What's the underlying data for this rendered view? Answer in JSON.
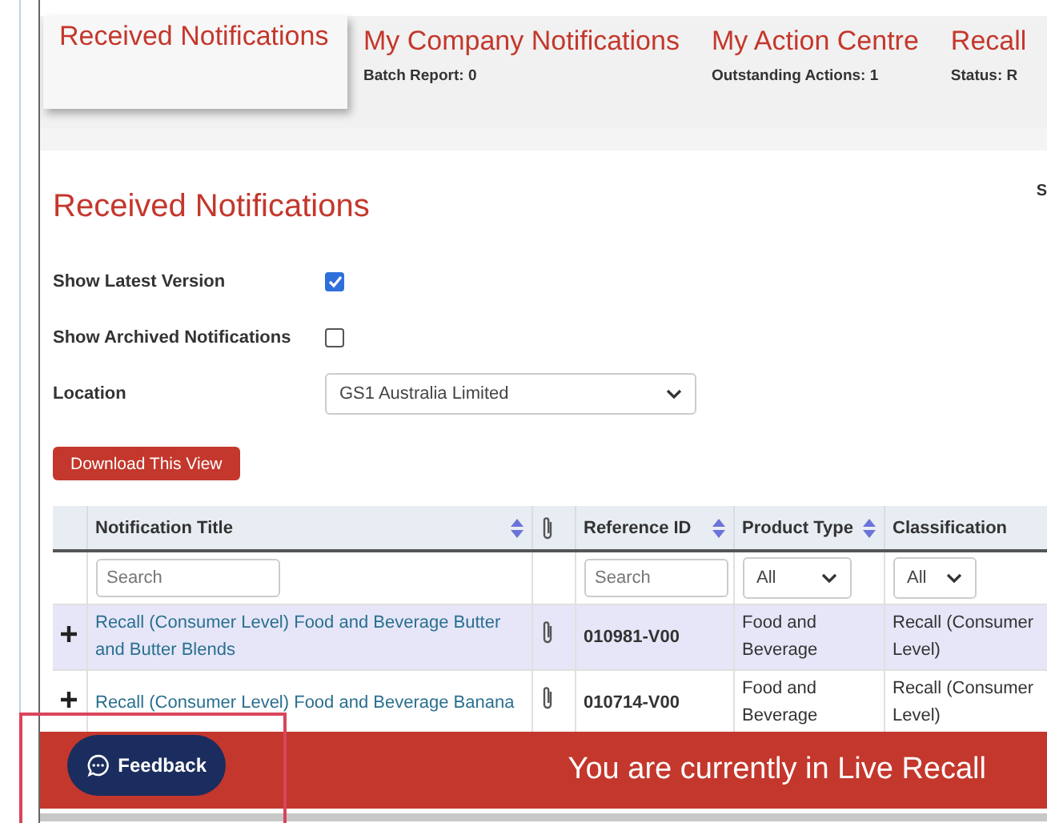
{
  "tabs": [
    {
      "title": "Received Notifications",
      "selected": true
    },
    {
      "title": "My Company Notifications",
      "subtitle": "Batch Report: 0",
      "selected": false
    },
    {
      "title": "My Action Centre",
      "subtitle": "Outstanding Actions: 1",
      "selected": false
    },
    {
      "title": "Recall",
      "subtitle": "Status: R",
      "selected": false
    }
  ],
  "page_title": "Received Notifications",
  "side_label": "S",
  "filters": [
    {
      "kind": "checkbox",
      "label": "Show Latest Version",
      "checked": true
    },
    {
      "kind": "checkbox",
      "label": "Show Archived Notifications",
      "checked": false
    },
    {
      "kind": "select",
      "label": "Location",
      "value": "GS1 Australia Limited"
    }
  ],
  "download_button": "Download This View",
  "table": {
    "columns": [
      {
        "kind": "text",
        "label": "Notification Title",
        "sortable": true,
        "filter": {
          "kind": "search",
          "placeholder": "Search"
        }
      },
      {
        "kind": "attachment",
        "filter": {
          "kind": "none"
        }
      },
      {
        "kind": "text",
        "label": "Reference ID",
        "sortable": true,
        "filter": {
          "kind": "search",
          "placeholder": "Search"
        }
      },
      {
        "kind": "text",
        "label": "Product Type",
        "sortable": true,
        "filter": {
          "kind": "select",
          "value": "All"
        }
      },
      {
        "kind": "text",
        "label": "Classification",
        "filter": {
          "kind": "select",
          "value": "All"
        }
      }
    ],
    "rows": [
      {
        "selected": true,
        "title": "Recall (Consumer Level) Food and Beverage Butter and Butter Blends",
        "attachment": true,
        "reference": "010981-V00",
        "product_type": "Food and Beverage",
        "classification": "Recall (Consumer Level)"
      },
      {
        "selected": false,
        "title": "Recall (Consumer Level) Food and Beverage Banana",
        "attachment": true,
        "reference": "010714-V00",
        "product_type": "Food and Beverage",
        "classification": "Recall (Consumer Level)"
      }
    ]
  },
  "banner": "You are currently in Live Recall",
  "feedback_button": "Feedback"
}
